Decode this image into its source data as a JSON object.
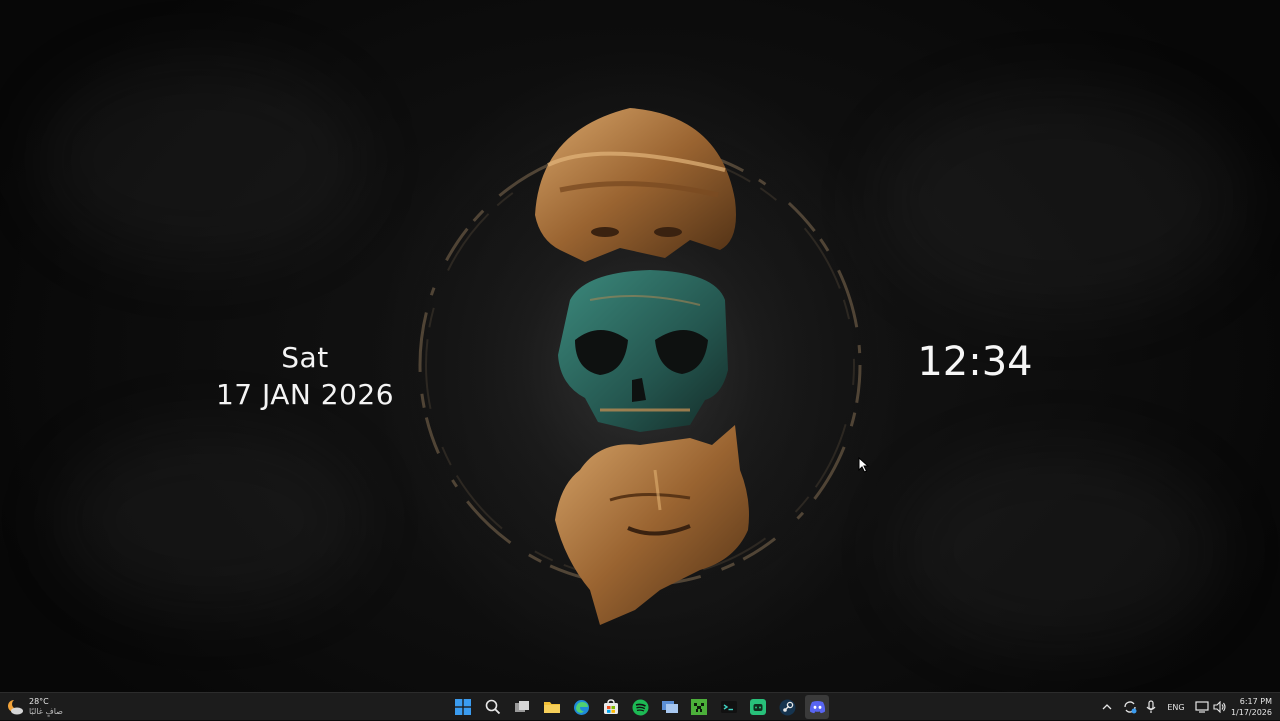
{
  "wallpaper_widgets": {
    "day": "Sat",
    "date": "17 JAN 2026",
    "clock": "12:34"
  },
  "taskbar": {
    "weather": {
      "temperature": "28°C",
      "condition": "صافٍ غالبًا",
      "icon": "moon-cloud-icon"
    },
    "apps": [
      {
        "name": "start",
        "icon": "windows-logo-icon"
      },
      {
        "name": "search",
        "icon": "search-icon"
      },
      {
        "name": "task-view",
        "icon": "task-view-icon"
      },
      {
        "name": "file-explorer",
        "icon": "folder-icon"
      },
      {
        "name": "edge",
        "icon": "edge-icon"
      },
      {
        "name": "microsoft-store",
        "icon": "store-icon"
      },
      {
        "name": "spotify",
        "icon": "spotify-icon"
      },
      {
        "name": "windows-app",
        "icon": "app-window-icon"
      },
      {
        "name": "minecraft",
        "icon": "minecraft-icon"
      },
      {
        "name": "terminal-app",
        "icon": "terminal-icon"
      },
      {
        "name": "android-app",
        "icon": "android-icon"
      },
      {
        "name": "steam",
        "icon": "steam-icon"
      },
      {
        "name": "discord",
        "icon": "discord-icon",
        "active": true
      }
    ],
    "tray": {
      "language": "ENG",
      "time": "6:17 PM",
      "date": "1/17/2026"
    }
  },
  "colors": {
    "taskbar_bg": "#1c1c1c",
    "spotify_green": "#1db954",
    "discord_blurple": "#5865f2",
    "windows_blue": "#3b9cf0",
    "bronze": "#a8743a",
    "patina": "#2f6a62"
  }
}
